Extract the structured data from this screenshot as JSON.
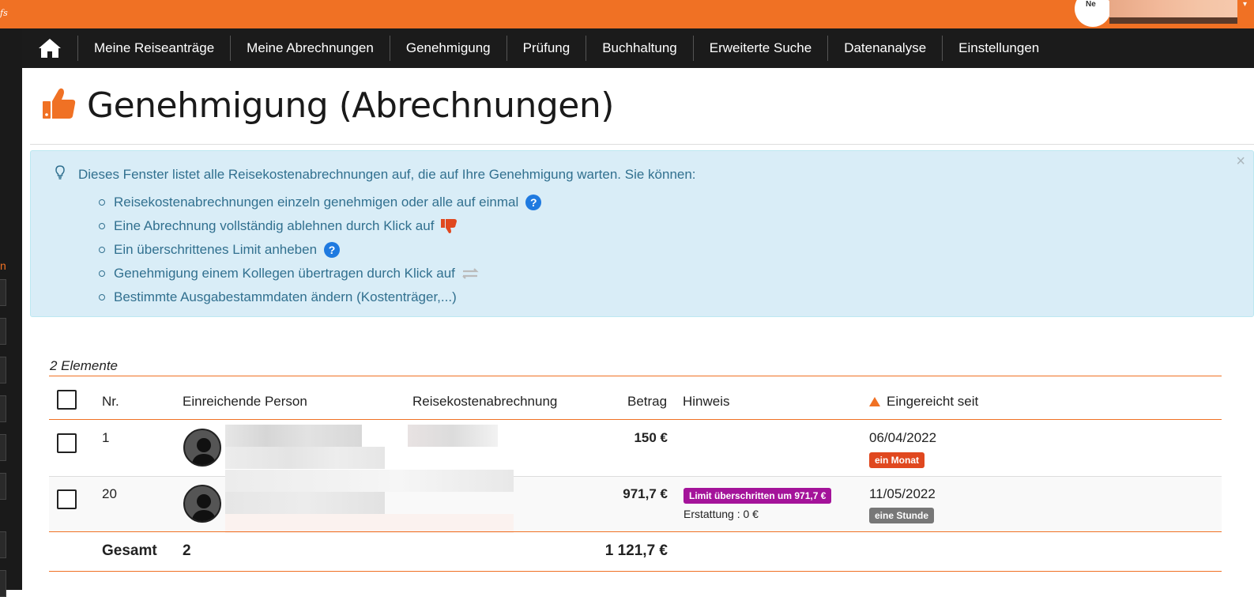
{
  "brand": "fs",
  "logo_text": "Ne",
  "nav": {
    "items": [
      {
        "label": "Meine Reiseanträge"
      },
      {
        "label": "Meine Abrechnungen"
      },
      {
        "label": "Genehmigung"
      },
      {
        "label": "Prüfung"
      },
      {
        "label": "Buchhaltung"
      },
      {
        "label": "Erweiterte Suche"
      },
      {
        "label": "Datenanalyse"
      },
      {
        "label": "Einstellungen"
      }
    ]
  },
  "page": {
    "title": "Genehmigung (Abrechnungen)"
  },
  "info": {
    "intro": "Dieses Fenster listet alle Reisekostenabrechnungen auf, die auf Ihre Genehmigung warten. Sie können:",
    "items": [
      {
        "text": "Reisekostenabrechnungen einzeln genehmigen oder alle auf einmal"
      },
      {
        "text": "Eine Abrechnung vollständig ablehnen durch Klick auf"
      },
      {
        "text": "Ein überschrittenes Limit anheben"
      },
      {
        "text": "Genehmigung einem Kollegen übertragen durch Klick auf"
      },
      {
        "text": "Bestimmte Ausgabestammdaten ändern (Kostenträger,...)"
      }
    ],
    "close": "×",
    "help_glyph": "?"
  },
  "table": {
    "count_label": "2 Elemente",
    "headers": {
      "nr": "Nr.",
      "person": "Einreichende Person",
      "report": "Reisekostenabrechnung",
      "amount": "Betrag",
      "note": "Hinweis",
      "submitted": "Eingereicht seit"
    },
    "rows": [
      {
        "nr": "1",
        "amount": "150 €",
        "date": "06/04/2022",
        "age_badge": "ein Monat",
        "note_badge": "",
        "note_text": ""
      },
      {
        "nr": "20",
        "amount": "971,7 €",
        "date": "11/05/2022",
        "age_badge": "eine Stunde",
        "note_badge": "Limit überschritten um 971,7 €",
        "note_text": "Erstattung : 0 €"
      }
    ],
    "total": {
      "label": "Gesamt",
      "count": "2",
      "amount": "1 121,7 €"
    }
  },
  "colors": {
    "accent": "#f07124",
    "navbar": "#1b1b1b",
    "info_bg": "#d9edf7",
    "info_text": "#31708f",
    "badge_red": "#e0481f",
    "badge_gray": "#777777",
    "badge_purple": "#a4139a"
  }
}
